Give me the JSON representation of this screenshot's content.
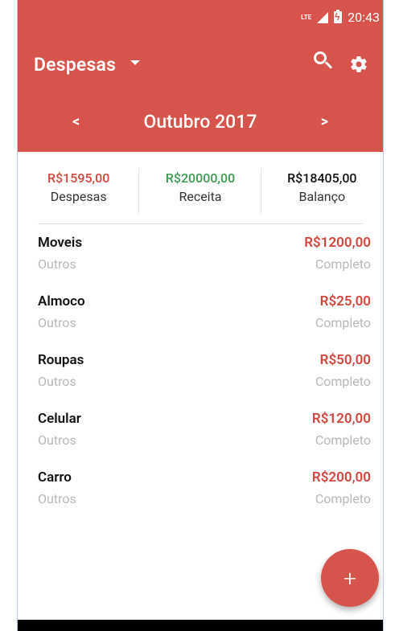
{
  "status": {
    "time": "20:43",
    "network": "LTE"
  },
  "header": {
    "title": "Despesas",
    "month": "Outubro 2017",
    "prev_label": "<",
    "next_label": ">"
  },
  "summary": [
    {
      "value": "R$1595,00",
      "label": "Despesas",
      "color": "#d4463d"
    },
    {
      "value": "R$20000,00",
      "label": "Receita",
      "color": "#3a9a52"
    },
    {
      "value": "R$18405,00",
      "label": "Balanço",
      "color": "#111111"
    }
  ],
  "items": [
    {
      "name": "Moveis",
      "category": "Outros",
      "value": "R$1200,00",
      "status": "Completo"
    },
    {
      "name": "Almoco",
      "category": "Outros",
      "value": "R$25,00",
      "status": "Completo"
    },
    {
      "name": "Roupas",
      "category": "Outros",
      "value": "R$50,00",
      "status": "Completo"
    },
    {
      "name": "Celular",
      "category": "Outros",
      "value": "R$120,00",
      "status": "Completo"
    },
    {
      "name": "Carro",
      "category": "Outros",
      "value": "R$200,00",
      "status": "Completo"
    }
  ],
  "fab": {
    "label": "+"
  },
  "icons": {
    "search": "search-icon",
    "settings": "gear-icon",
    "dropdown": "caret-down-icon"
  },
  "colors": {
    "primary": "#d6544b",
    "expense": "#d4463d",
    "income": "#3a9a52"
  }
}
